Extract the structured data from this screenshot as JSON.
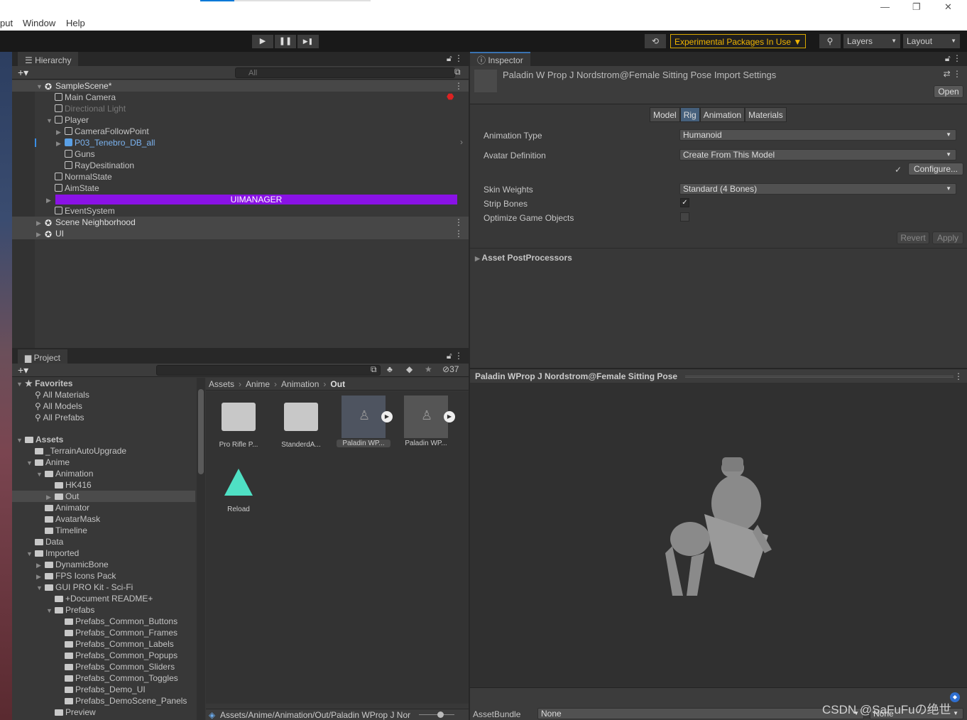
{
  "menubar": {
    "items": [
      "put",
      "Window",
      "Help"
    ]
  },
  "toolbar": {
    "play": "▶",
    "pause": "❚❚",
    "step": "▶❚",
    "history_icon": "history-icon",
    "experimental": "Experimental Packages In Use ▼",
    "search_icon": "search-icon",
    "layers": "Layers",
    "layout": "Layout"
  },
  "hierarchy": {
    "tab": "Hierarchy",
    "add": "+▾",
    "search_placeholder": "All",
    "rows": [
      {
        "label": "SampleScene*",
        "level": 0,
        "arrow": "▼",
        "type": "scene",
        "header": true
      },
      {
        "label": "Main Camera",
        "level": 1,
        "arrow": "",
        "type": "cube"
      },
      {
        "label": "Directional Light",
        "level": 1,
        "arrow": "",
        "type": "cube",
        "disabled": true
      },
      {
        "label": "Player",
        "level": 1,
        "arrow": "▼",
        "type": "cube"
      },
      {
        "label": "CameraFollowPoint",
        "level": 2,
        "arrow": "▶",
        "type": "cube"
      },
      {
        "label": "P03_Tenebro_DB_all",
        "level": 2,
        "arrow": "▶",
        "type": "prefab",
        "prefab": true
      },
      {
        "label": "Guns",
        "level": 2,
        "arrow": "",
        "type": "cube"
      },
      {
        "label": "RayDesitination",
        "level": 2,
        "arrow": "",
        "type": "cube"
      },
      {
        "label": "NormalState",
        "level": 1,
        "arrow": "",
        "type": "cube"
      },
      {
        "label": "AimState",
        "level": 1,
        "arrow": "",
        "type": "cube"
      },
      {
        "label": "UIMANAGER",
        "level": 1,
        "arrow": "▶",
        "type": "banner",
        "banner": true
      },
      {
        "label": "EventSystem",
        "level": 1,
        "arrow": "",
        "type": "cube"
      },
      {
        "label": "Scene Neighborhood",
        "level": 0,
        "arrow": "▶",
        "type": "scene",
        "header": true
      },
      {
        "label": "UI",
        "level": 0,
        "arrow": "▶",
        "type": "scene",
        "header": true
      }
    ]
  },
  "inspector": {
    "tab": "Inspector",
    "title": "Paladin W Prop J Nordstrom@Female Sitting Pose Import Settings",
    "open": "Open",
    "tabs": [
      "Model",
      "Rig",
      "Animation",
      "Materials"
    ],
    "active_tab": "Rig",
    "animation_type_label": "Animation Type",
    "animation_type": "Humanoid",
    "avatar_label": "Avatar Definition",
    "avatar": "Create From This Model",
    "configure": "Configure...",
    "check": "✓",
    "skin_label": "Skin Weights",
    "skin": "Standard (4 Bones)",
    "strip_label": "Strip Bones",
    "strip": true,
    "optimize_label": "Optimize Game Objects",
    "optimize": false,
    "revert": "Revert",
    "apply": "Apply",
    "postprocessors": "Asset PostProcessors",
    "preview_title": "Paladin WProp J Nordstrom@Female Sitting Pose",
    "assetbundle_label": "AssetBundle",
    "assetbundle": "None",
    "assetbundle_variant": "None"
  },
  "project": {
    "tab": "Project",
    "add": "+▾",
    "hidden_count": "37",
    "favorites": {
      "label": "Favorites",
      "items": [
        "All Materials",
        "All Models",
        "All Prefabs"
      ]
    },
    "tree": [
      {
        "label": "Assets",
        "level": 0,
        "arrow": "▼",
        "bold": true
      },
      {
        "label": "_TerrainAutoUpgrade",
        "level": 1,
        "arrow": ""
      },
      {
        "label": "Anime",
        "level": 1,
        "arrow": "▼"
      },
      {
        "label": "Animation",
        "level": 2,
        "arrow": "▼"
      },
      {
        "label": "HK416",
        "level": 3,
        "arrow": ""
      },
      {
        "label": "Out",
        "level": 3,
        "arrow": "▶",
        "selected": true
      },
      {
        "label": "Animator",
        "level": 2,
        "arrow": ""
      },
      {
        "label": "AvatarMask",
        "level": 2,
        "arrow": ""
      },
      {
        "label": "Timeline",
        "level": 2,
        "arrow": ""
      },
      {
        "label": "Data",
        "level": 1,
        "arrow": ""
      },
      {
        "label": "Imported",
        "level": 1,
        "arrow": "▼"
      },
      {
        "label": "DynamicBone",
        "level": 2,
        "arrow": "▶"
      },
      {
        "label": "FPS Icons Pack",
        "level": 2,
        "arrow": "▶"
      },
      {
        "label": "GUI PRO Kit - Sci-Fi",
        "level": 2,
        "arrow": "▼"
      },
      {
        "label": "+Document README+",
        "level": 3,
        "arrow": ""
      },
      {
        "label": "Prefabs",
        "level": 3,
        "arrow": "▼"
      },
      {
        "label": "Prefabs_Common_Buttons",
        "level": 4,
        "arrow": ""
      },
      {
        "label": "Prefabs_Common_Frames",
        "level": 4,
        "arrow": ""
      },
      {
        "label": "Prefabs_Common_Labels",
        "level": 4,
        "arrow": ""
      },
      {
        "label": "Prefabs_Common_Popups",
        "level": 4,
        "arrow": ""
      },
      {
        "label": "Prefabs_Common_Sliders",
        "level": 4,
        "arrow": ""
      },
      {
        "label": "Prefabs_Common_Toggles",
        "level": 4,
        "arrow": ""
      },
      {
        "label": "Prefabs_Demo_UI",
        "level": 4,
        "arrow": ""
      },
      {
        "label": "Prefabs_DemoScene_Panels",
        "level": 4,
        "arrow": ""
      },
      {
        "label": "Preview",
        "level": 3,
        "arrow": ""
      }
    ],
    "breadcrumb": [
      "Assets",
      "Anime",
      "Animation",
      "Out"
    ],
    "assets": [
      {
        "label": "Pro Rifle P...",
        "type": "folder"
      },
      {
        "label": "StanderdA...",
        "type": "folder"
      },
      {
        "label": "Paladin WP...",
        "type": "anim",
        "selected": true
      },
      {
        "label": "Paladin WP...",
        "type": "anim"
      },
      {
        "label": "Reload",
        "type": "script"
      }
    ],
    "status_path": "Assets/Anime/Animation/Out/Paladin WProp J Nor"
  },
  "watermark": "CSDN @SaFuFuの绝世"
}
